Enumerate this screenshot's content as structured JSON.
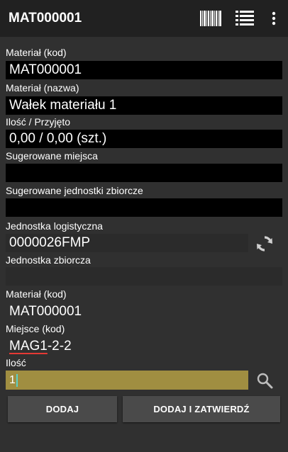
{
  "header": {
    "title": "MAT000001",
    "icons": [
      "barcode-icon",
      "list-icon",
      "more-vert-icon"
    ]
  },
  "form": {
    "material_code_label": "Materiał (kod)",
    "material_code_value": "MAT000001",
    "material_name_label": "Materiał (nazwa)",
    "material_name_value": "Wałek materiału 1",
    "quantity_received_label": "Ilość / Przyjęto",
    "quantity_received_value": "0,00 / 0,00 (szt.)",
    "suggested_locations_label": "Sugerowane miejsca",
    "suggested_locations_value": "",
    "suggested_units_label": "Sugerowane jednostki zbiorcze",
    "suggested_units_value": "",
    "logistic_unit_label": "Jednostka logistyczna",
    "logistic_unit_value": "0000026FMP",
    "collective_unit_label": "Jednostka zbiorcza",
    "collective_unit_value": "",
    "entry_material_code_label": "Materiał (kod)",
    "entry_material_code_value": "MAT000001",
    "location_code_label": "Miejsce (kod)",
    "location_code_value_part1": "MAG1",
    "location_code_value_part2": "-2-2",
    "quantity_label": "Ilość",
    "quantity_value": "1"
  },
  "buttons": {
    "add_label": "DODAJ",
    "add_confirm_label": "DODAJ I ZATWIERDŹ"
  },
  "colors": {
    "appbar": "#212121",
    "background": "#303030",
    "field_black": "#000000",
    "quantity_input": "#a08e41",
    "button": "#4a4a4a",
    "error_underline": "#e53935"
  }
}
